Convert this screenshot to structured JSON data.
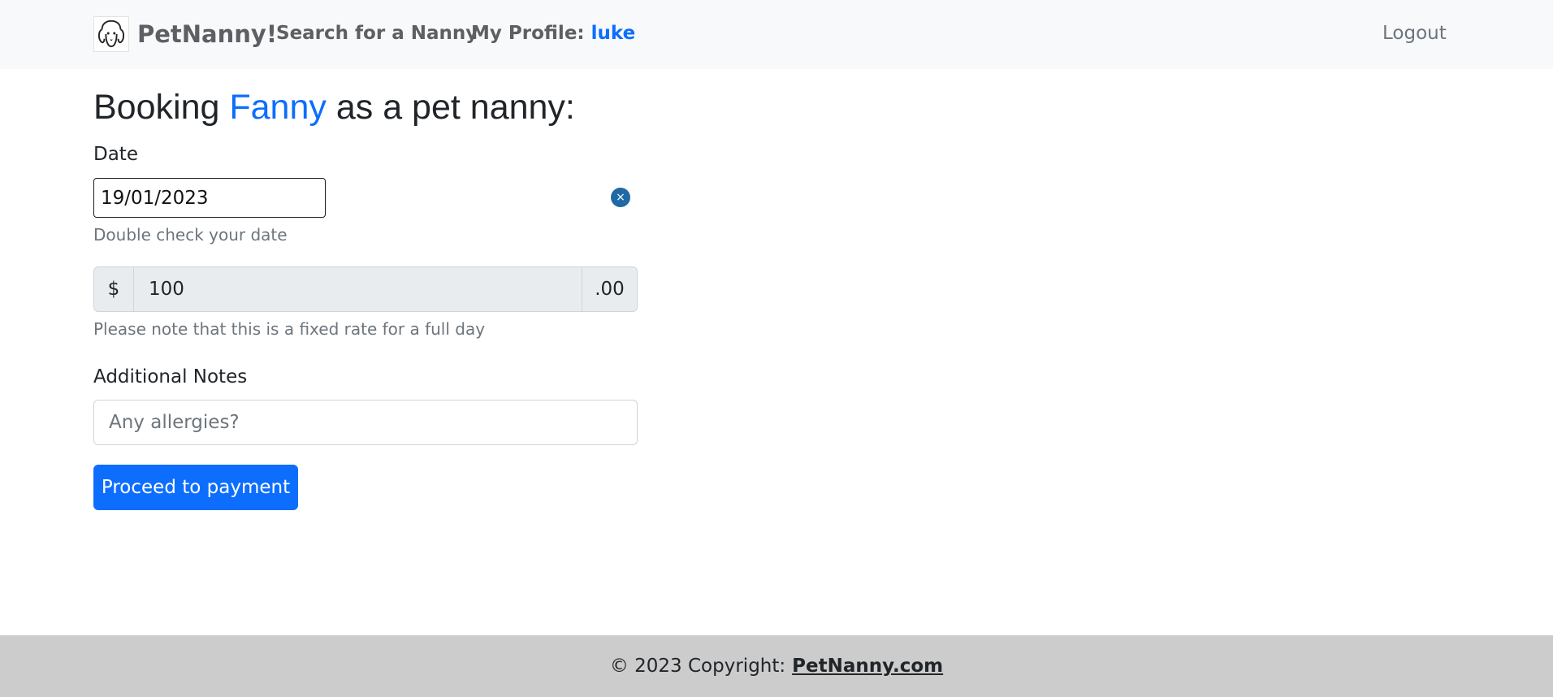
{
  "navbar": {
    "brand": "PetNanny!",
    "search_link": "Search for a Nanny",
    "profile_label": "My Profile:",
    "profile_user": "luke",
    "logout": "Logout"
  },
  "booking": {
    "heading_prefix": "Booking",
    "nanny_name": "Fanny",
    "heading_suffix": "as a pet nanny:",
    "date_label": "Date",
    "date_value": "19/01/2023",
    "date_clear": "×",
    "date_help": "Double check your date",
    "currency_prefix": "$",
    "rate_value": "100",
    "rate_suffix": ".00",
    "rate_help": "Please note that this is a fixed rate for a full day",
    "notes_label": "Additional Notes",
    "notes_placeholder": "Any allergies?",
    "submit": "Proceed to payment"
  },
  "footer": {
    "prefix": "© 2023 Copyright:",
    "link": "PetNanny.com"
  },
  "colors": {
    "primary": "#0d6efd",
    "navbar_bg": "#f8f9fa",
    "footer_bg": "#cccccc",
    "muted": "#6c757d"
  },
  "icons": {
    "logo": "dog-face-icon",
    "clear": "close-circle-icon"
  }
}
